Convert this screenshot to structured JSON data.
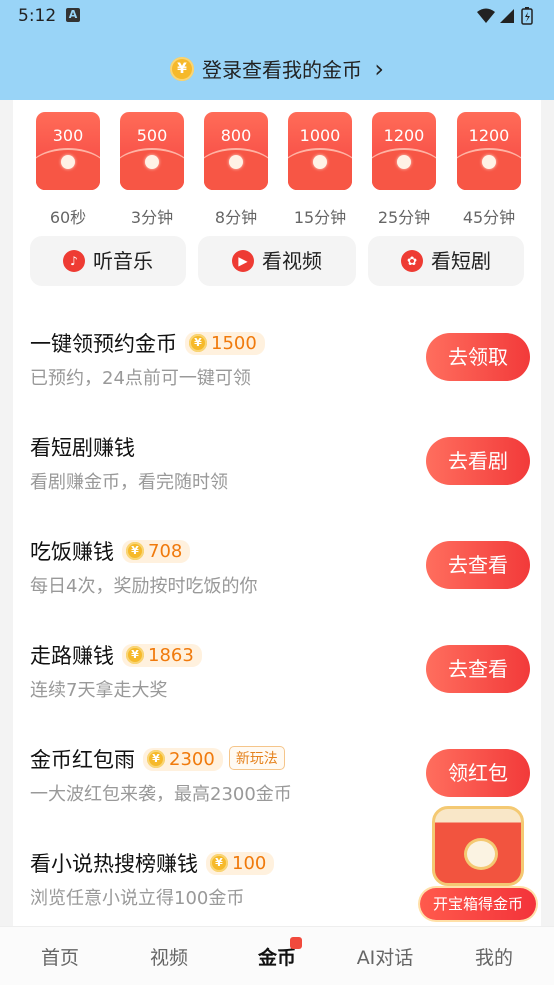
{
  "status": {
    "time": "5:12",
    "a_icon": "A"
  },
  "login": {
    "text": "登录查看我的金币",
    "chevron": "›"
  },
  "red_packets": [
    {
      "amount": "300",
      "label": "60秒"
    },
    {
      "amount": "500",
      "label": "3分钟"
    },
    {
      "amount": "800",
      "label": "8分钟"
    },
    {
      "amount": "1000",
      "label": "15分钟"
    },
    {
      "amount": "1200",
      "label": "25分钟"
    },
    {
      "amount": "1200",
      "label": "45分钟"
    }
  ],
  "chips": [
    {
      "label": "听音乐",
      "icon": "music-note-icon"
    },
    {
      "label": "看视频",
      "icon": "play-icon"
    },
    {
      "label": "看短剧",
      "icon": "film-reel-icon"
    }
  ],
  "tasks": [
    {
      "title": "一键领预约金币",
      "coins": "1500",
      "subtitle": "已预约，24点前可一键可领",
      "button": "去领取"
    },
    {
      "title": "看短剧赚钱",
      "coins": "",
      "subtitle": "看剧赚金币，看完随时领",
      "button": "去看剧"
    },
    {
      "title": "吃饭赚钱",
      "coins": "708",
      "subtitle": "每日4次，奖励按时吃饭的你",
      "button": "去查看"
    },
    {
      "title": "走路赚钱",
      "coins": "1863",
      "subtitle": "连续7天拿走大奖",
      "button": "去查看"
    },
    {
      "title": "金币红包雨",
      "coins": "2300",
      "tag": "新玩法",
      "subtitle": "一大波红包来袭，最高2300金币",
      "button": "领红包"
    },
    {
      "title": "看小说热搜榜赚钱",
      "coins": "100",
      "subtitle": "浏览任意小说立得100金币",
      "button": ""
    }
  ],
  "chest": {
    "label": "开宝箱得金币"
  },
  "tabs": [
    "首页",
    "视频",
    "金币",
    "AI对话",
    "我的"
  ],
  "active_tab": "金币",
  "colors": {
    "header_bg": "#99d4f7",
    "accent_red": "#f23a3a",
    "coin_orange": "#f07a0c"
  }
}
